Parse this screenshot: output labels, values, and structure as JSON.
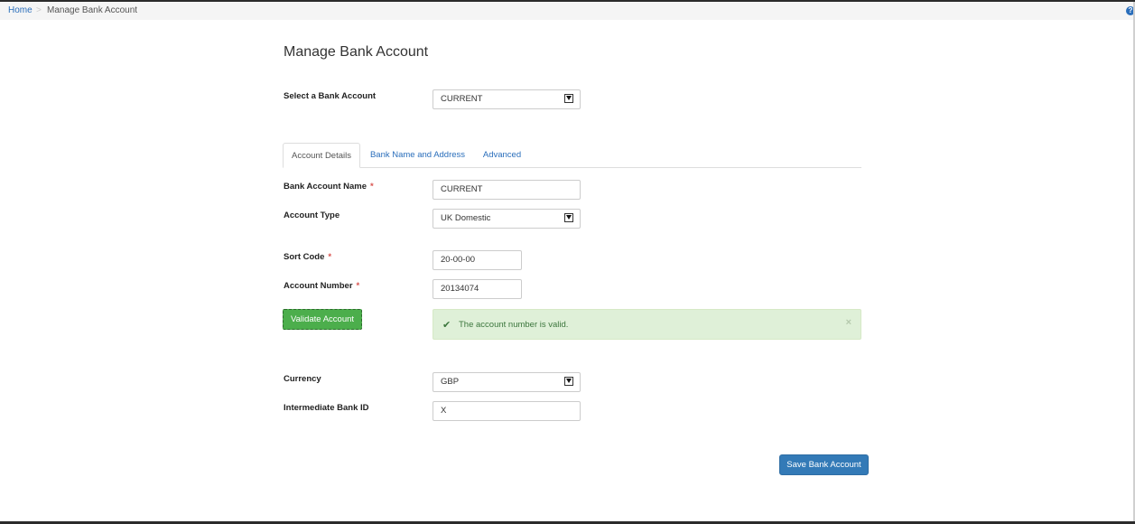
{
  "breadcrumb": {
    "home": "Home",
    "separator": ">",
    "current": "Manage Bank Account"
  },
  "help_icon": "?",
  "page": {
    "title": "Manage Bank Account"
  },
  "select_account": {
    "label": "Select a Bank Account",
    "value": "CURRENT"
  },
  "tabs": [
    {
      "label": "Account Details",
      "active": true
    },
    {
      "label": "Bank Name and Address",
      "active": false
    },
    {
      "label": "Advanced",
      "active": false
    }
  ],
  "form": {
    "account_name": {
      "label": "Bank Account Name",
      "required": "*",
      "value": "CURRENT"
    },
    "account_type": {
      "label": "Account Type",
      "value": "UK Domestic"
    },
    "sort_code": {
      "label": "Sort Code",
      "required": "*",
      "value": "20-00-00"
    },
    "account_number": {
      "label": "Account Number",
      "required": "*",
      "value": "20134074"
    },
    "currency": {
      "label": "Currency",
      "value": "GBP"
    },
    "intermediate_bank": {
      "label": "Intermediate Bank ID",
      "value": "X"
    }
  },
  "validate_button": "Validate Account",
  "alert": {
    "icon": "check-icon",
    "message": "The account number is valid.",
    "close": "×"
  },
  "save_button": "Save Bank Account",
  "colors": {
    "link": "#2a6ebb",
    "success_button": "#4cae4c",
    "primary_button": "#337ab7",
    "alert_bg": "#dff0d8",
    "required": "#d9534f"
  }
}
